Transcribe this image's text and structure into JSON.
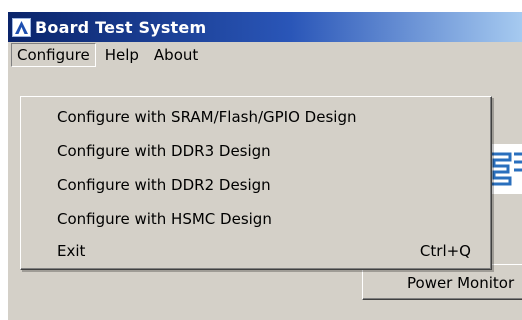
{
  "window": {
    "title": "Board Test System",
    "logo_letter": "A"
  },
  "menubar": {
    "items": [
      {
        "label": "Configure"
      },
      {
        "label": "Help"
      },
      {
        "label": "About"
      }
    ]
  },
  "dropdown": {
    "items": [
      {
        "label": "Configure with SRAM/Flash/GPIO Design",
        "shortcut": ""
      },
      {
        "label": "Configure with DDR3 Design",
        "shortcut": ""
      },
      {
        "label": "Configure with DDR2 Design",
        "shortcut": ""
      },
      {
        "label": "Configure with HSMC Design",
        "shortcut": ""
      },
      {
        "label": "Exit",
        "shortcut": "Ctrl+Q"
      }
    ]
  },
  "content": {
    "power_button_label": "Power Monitor"
  },
  "colors": {
    "titlebar_start": "#0a246a",
    "titlebar_end": "#a6caf0",
    "chrome": "#d4d0c8",
    "logo_blue": "#2a56b8"
  },
  "icons": {
    "app_logo": "altera-logo-icon"
  }
}
